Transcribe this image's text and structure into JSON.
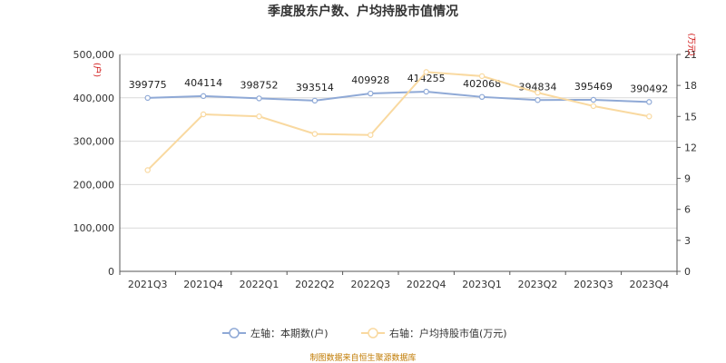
{
  "chart_data": {
    "type": "line",
    "title": "季度股东户数、户均持股市值情况",
    "categories": [
      "2021Q3",
      "2021Q4",
      "2022Q1",
      "2022Q2",
      "2022Q3",
      "2022Q4",
      "2023Q1",
      "2023Q2",
      "2023Q3",
      "2023Q4"
    ],
    "left_axis": {
      "unit": "(户)",
      "ylim": [
        0,
        500000
      ],
      "ticks": [
        "0",
        "100,000",
        "200,000",
        "300,000",
        "400,000",
        "500,000"
      ],
      "tick_values": [
        0,
        100000,
        200000,
        300000,
        400000,
        500000
      ]
    },
    "right_axis": {
      "unit": "(万元)",
      "ylim": [
        0,
        21
      ],
      "ticks": [
        "0",
        "3",
        "6",
        "9",
        "12",
        "15",
        "18",
        "21"
      ],
      "tick_values": [
        0,
        3,
        6,
        9,
        12,
        15,
        18,
        21
      ]
    },
    "series": [
      {
        "name": "左轴：本期数(户)",
        "axis": "left",
        "color": "#8fa9d6",
        "values": [
          399775,
          404114,
          398752,
          393514,
          409928,
          414255,
          402068,
          394834,
          395469,
          390492
        ],
        "labels": [
          "399775",
          "404114",
          "398752",
          "393514",
          "409928",
          "414255",
          "402068",
          "394834",
          "395469",
          "390492"
        ]
      },
      {
        "name": "右轴：户均持股市值(万元)",
        "axis": "right",
        "color": "#f9d9a0",
        "values": [
          9.8,
          15.2,
          15.0,
          13.3,
          13.2,
          19.3,
          18.9,
          17.3,
          16.0,
          15.0
        ]
      }
    ],
    "grid": true,
    "legend": "bottom"
  },
  "source": "制图数据来自恒生聚源数据库"
}
